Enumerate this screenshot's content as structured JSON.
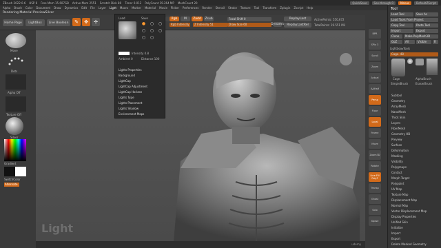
{
  "titlebar": {
    "app": "ZBrush 2022.0.6",
    "stats": [
      "HSP 6",
      "Free Mem 15.607GB",
      "Active Mem 2551",
      "Scratch Disk 80",
      "Timer 0.012",
      "PolyCount 19.264 MP",
      "MeshCount 20"
    ],
    "quicksave": "QuickSave",
    "seethrough": "See-through 0",
    "menus": "Menus",
    "script": "DefaultZScript"
  },
  "menubar": [
    "Alpha",
    "Brush",
    "Color",
    "Document",
    "Draw",
    "Dynamics",
    "Edit",
    "File",
    "Layer",
    "Light",
    "Macro",
    "Marker",
    "Material",
    "Movie",
    "Picker",
    "Preferences",
    "Render",
    "Stencil",
    "Stroke",
    "Texture",
    "Tool",
    "Transform",
    "Zplugin",
    "Zscript",
    "Help"
  ],
  "subtitle": "Rendering Material PreviewSilver",
  "toolbar": {
    "home": "Home Page",
    "lightbox": "LightBox",
    "livebool": "Live Boolean",
    "rgb": "Rgb",
    "m": "M",
    "zadd": "Zadd",
    "zsub": "Zsub",
    "zcut": "Zcut",
    "focal": "Focal Shift 0",
    "drawsize": "Draw Size 60",
    "zintensity": "Z Intensity 51",
    "rgbint": "Rgb Intensity",
    "replaylast": "ReplayLast",
    "replaylastrel": "ReplayLastRel",
    "activepoints": "ActivePoints: 550,672",
    "totalpoints": "TotalPoints: 19.551 Mil",
    "dynamic": "Dynamic"
  },
  "lightmenu": {
    "load": "Load",
    "save": "Save",
    "intensity": "Intensity 0.8",
    "ambient": "Ambient 0",
    "distance": "Distance 100",
    "items": [
      "Lights Properties",
      "Background",
      "LightCap",
      "LightCap Adjustment",
      "LightCap Horizon",
      "Lights Type",
      "Lights Placement",
      "Lights Shadow",
      "Environment Maps"
    ]
  },
  "leftshelf": {
    "move": "Move",
    "dots": "Dots",
    "alphaoff": "Alpha Off",
    "textureoff": "Texture Off",
    "silver": "Silver",
    "gradient": "Gradient",
    "switchcolor": "SwitchColor",
    "alternate": "Alternate"
  },
  "canvas_label": "Light",
  "rightcol": [
    "BPR",
    "SPix 3",
    "Scroll",
    "Zoom",
    "Actual",
    "AAHalf",
    "Persp",
    "Floor",
    "Local",
    "Frame",
    "Move",
    "Zoom3D",
    "Rotate",
    "Line Fill PolyF",
    "Transp",
    "Ghost",
    "Solo",
    "Xpose"
  ],
  "toolpanel": {
    "title": "Tool",
    "btns": [
      "Load Tool",
      "Save As",
      "Load Tools From Project",
      "Copy Tool",
      "Paste Tool",
      "Import",
      "Export",
      "Clone",
      "Make PolyMesh3D",
      "GoZ",
      "All",
      "Visible",
      "R"
    ],
    "lightbox_tools": "Lightbox▸Tools",
    "cage": "Cage. 48",
    "thumbs": [
      "Cage",
      "SimpleBrush",
      "AlphaBrush",
      "EraserBrush"
    ],
    "items": [
      "Subtool",
      "Geometry",
      "ArrayMesh",
      "NanoMesh",
      "Thick Skin",
      "Layers",
      "FiberMesh",
      "Geometry HD",
      "Preview",
      "Surface",
      "Deformation",
      "Masking",
      "Visibility",
      "Polygroups",
      "Contact",
      "Morph Target",
      "Polypaint",
      "UV Map",
      "Texture Map",
      "Displacement Map",
      "Normal Map",
      "Vector Displacement Map",
      "Display Properties",
      "Unified Skin",
      "Initialize",
      "Import",
      "Export",
      "Delete Masked Geometry"
    ]
  },
  "watermark": "udemy",
  "colors": {
    "accent": "#d26a1a",
    "bg": "#3a3a3a"
  }
}
